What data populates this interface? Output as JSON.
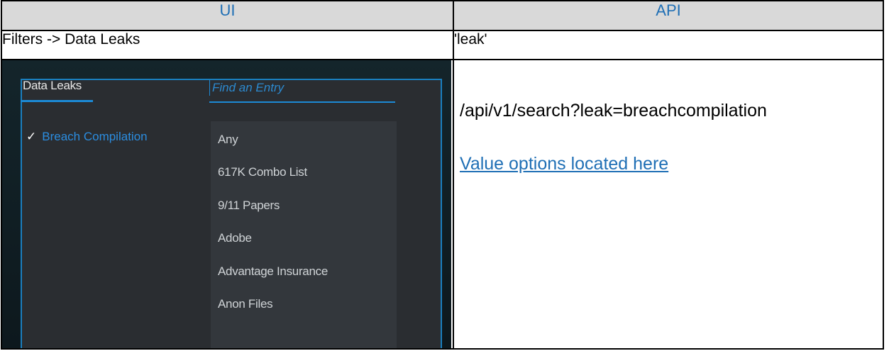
{
  "header": {
    "col1": "UI",
    "col2": "API"
  },
  "row2": {
    "ui": "Filters -> Data Leaks",
    "api": "'leak'"
  },
  "screenshot": {
    "tab_label": "Data Leaks",
    "search_placeholder": "Find an Entry",
    "selected_item": "Breach Compilation",
    "check_glyph": "✓",
    "list_items": [
      "Any",
      "617K Combo List",
      "9/11 Papers",
      "Adobe",
      "Advantage Insurance",
      "Anon Files"
    ]
  },
  "api_cell": {
    "endpoint": "/api/v1/search?leak=breachcompilation",
    "link_text": "Value options located here"
  },
  "colors": {
    "header_text": "#1f6fb5",
    "accent": "#1c8ad6",
    "link": "#1f6fb5"
  }
}
